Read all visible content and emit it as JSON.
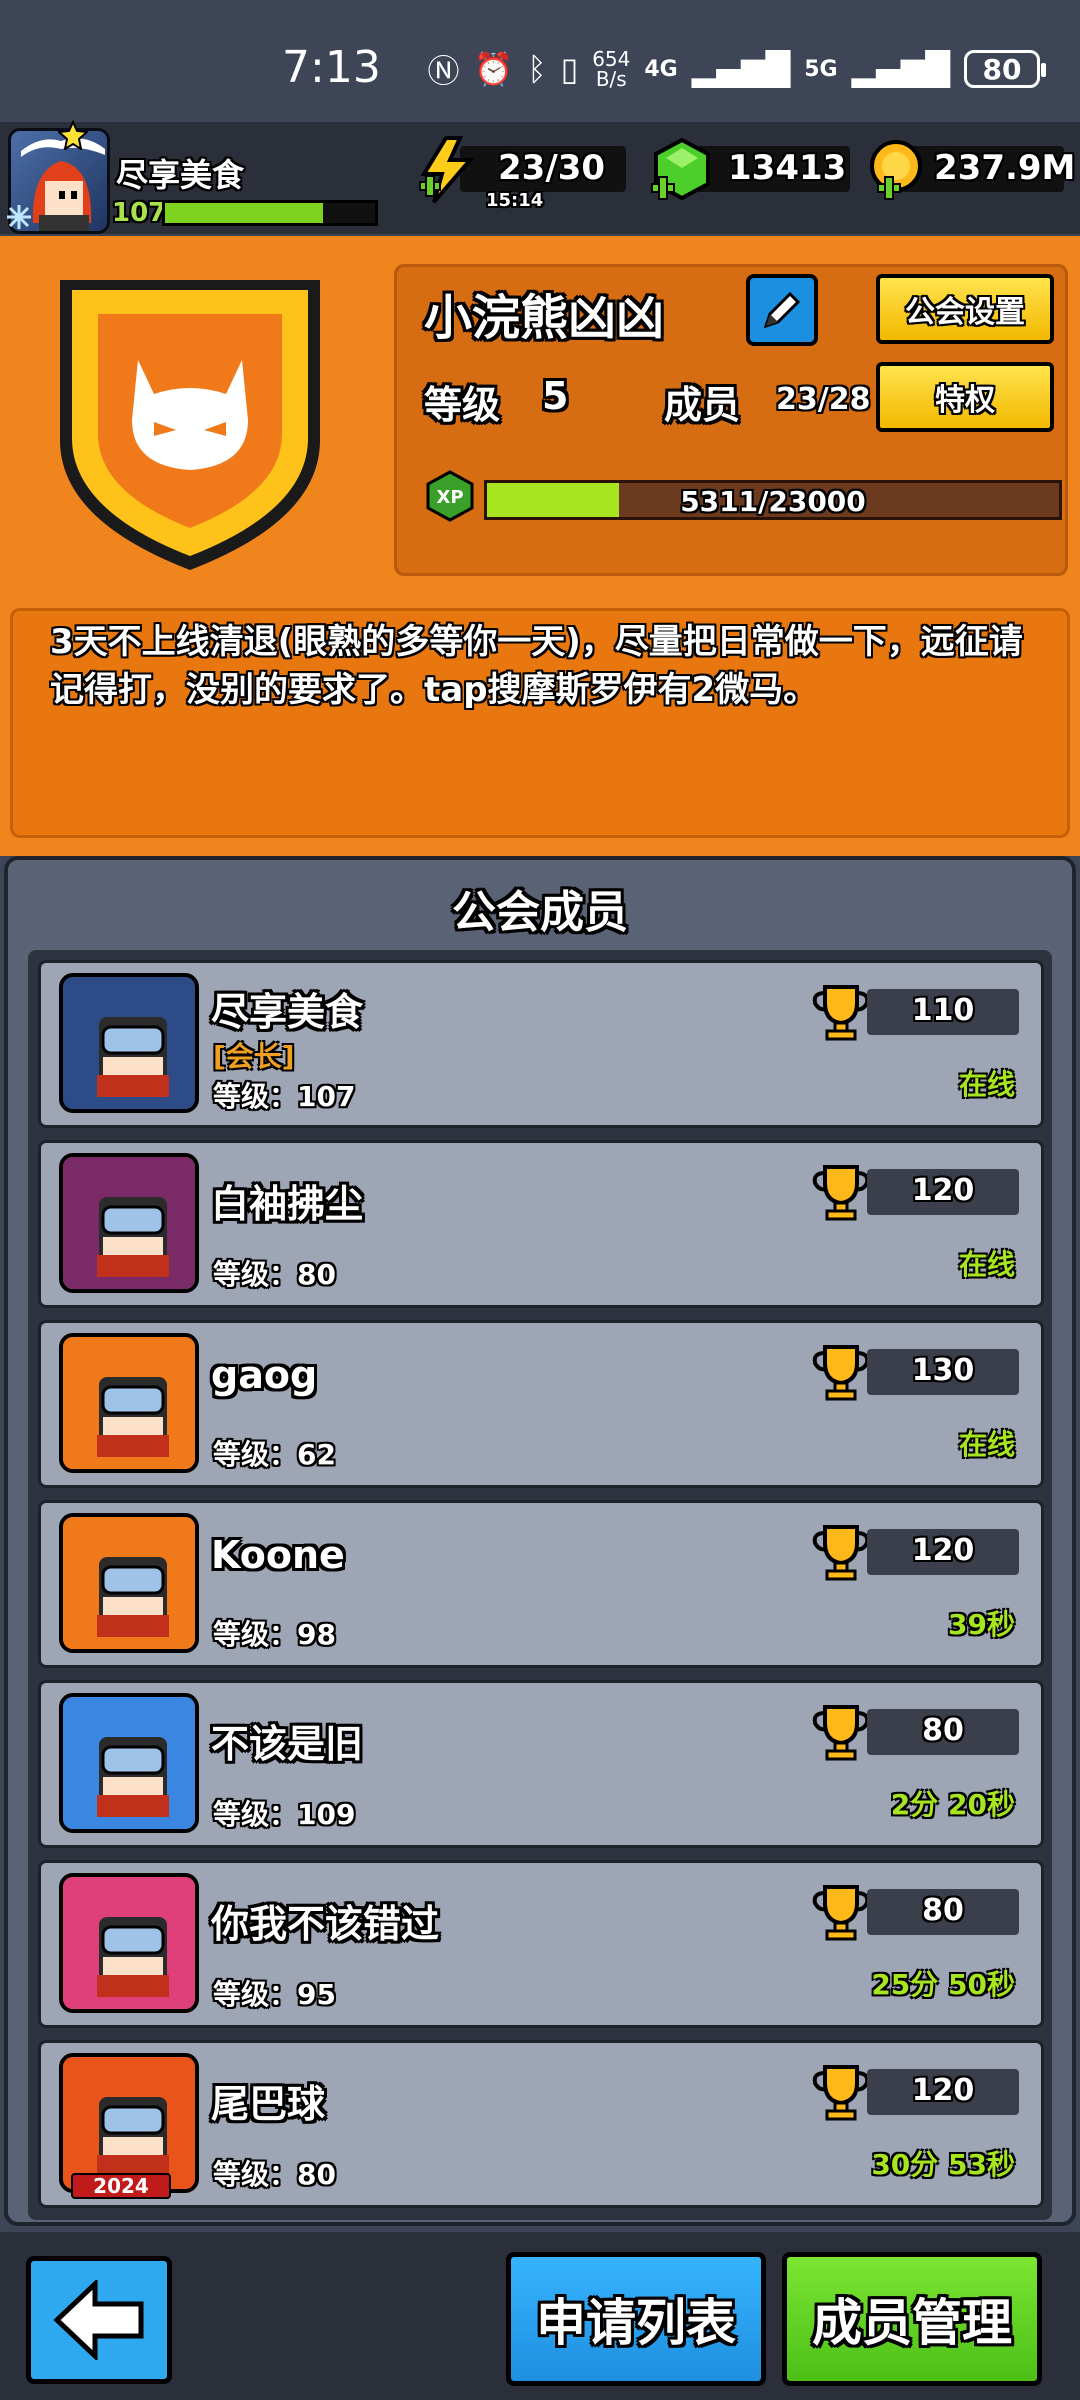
{
  "status_bar": {
    "time": "7:13",
    "net_speed_value": "654",
    "net_speed_unit": "B/s",
    "net_4g": "4G",
    "net_5g": "5G",
    "battery": "80"
  },
  "player": {
    "name": "尽享美食",
    "level": "107",
    "xp_progress": 0.75
  },
  "resources": {
    "energy": "23/30",
    "energy_timer": "15:14",
    "gems": "13413",
    "coins": "237.9M"
  },
  "guild": {
    "name": "小浣熊凶凶",
    "settings_label": "公会设置",
    "privileges_label": "特权",
    "level_label": "等级",
    "level_value": "5",
    "members_label": "成员",
    "members_value": "23/28",
    "xp_badge": "XP",
    "xp_text": "5311/23000",
    "xp_current": 5311,
    "xp_max": 23000,
    "description": "3天不上线清退(眼熟的多等你一天)，尽量把日常做一下，远征请记得打，没别的要求了。tap搜摩斯罗伊有2微马。"
  },
  "members_title": "公会成员",
  "members": [
    {
      "name": "尽享美食",
      "role": "[会长]",
      "level_text": "等级：107",
      "trophies": "110",
      "status": "在线",
      "avatar_bg": "#2d4b86",
      "avatar_frame": "#2a3f7a"
    },
    {
      "name": "白袖拂尘",
      "role": "",
      "level_text": "等级：80",
      "trophies": "120",
      "status": "在线",
      "avatar_bg": "#7a2a66",
      "avatar_frame": "#6ad12a"
    },
    {
      "name": "gaog",
      "role": "",
      "level_text": "等级：62",
      "trophies": "130",
      "status": "在线",
      "avatar_bg": "#f07a1a",
      "avatar_frame": "#f07a1a"
    },
    {
      "name": "Koone",
      "role": "",
      "level_text": "等级：98",
      "trophies": "120",
      "status": "39秒",
      "avatar_bg": "#f07a1a",
      "avatar_frame": "#f07a1a"
    },
    {
      "name": "不该是旧",
      "role": "",
      "level_text": "等级：109",
      "trophies": "80",
      "status": "2分 20秒",
      "avatar_bg": "#3a86e0",
      "avatar_frame": "#3a86e0"
    },
    {
      "name": "你我不该错过",
      "role": "",
      "level_text": "等级：95",
      "trophies": "80",
      "status": "25分 50秒",
      "avatar_bg": "#e0407a",
      "avatar_frame": "#e0407a"
    },
    {
      "name": "尾巴球",
      "role": "",
      "level_text": "等级：80",
      "trophies": "120",
      "status": "30分 53秒",
      "avatar_bg": "#e8541a",
      "avatar_frame": "#e8541a",
      "badge": "2024"
    }
  ],
  "bottom": {
    "apply_list_label": "申请列表",
    "manage_label": "成员管理"
  },
  "colors": {
    "orange": "#f0841d",
    "panel": "#5a6275",
    "online_green": "#a6e51f",
    "yellow_button": "#ffd21a",
    "blue_button": "#2ea8ee",
    "green_button": "#6ad12a"
  },
  "icons": {
    "energy": "lightning-icon",
    "gems": "green-gem-icon",
    "coins": "gold-coin-icon",
    "edit": "pencil-icon",
    "back": "back-arrow-icon",
    "trophy": "trophy-icon",
    "guild_emblem": "cat-shield-icon"
  }
}
